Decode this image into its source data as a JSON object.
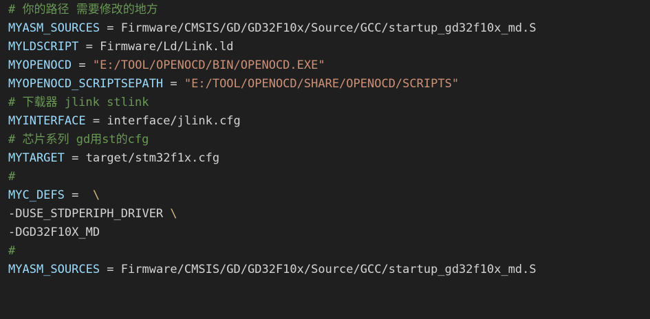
{
  "editor": {
    "lines": [
      {
        "comment": "# 你的路径 需要修改的地方"
      },
      {
        "var": "MYASM_SOURCES",
        "op": " = ",
        "val": "Firmware/CMSIS/GD/GD32F10x/Source/GCC/startup_gd32f10x_md.S"
      },
      {
        "var": "MYLDSCRIPT",
        "op": " = ",
        "val": "Firmware/Ld/Link.ld"
      },
      {
        "var": "MYOPENOCD",
        "op": " = ",
        "str": "\"E:/TOOL/OPENOCD/BIN/OPENOCD.EXE\""
      },
      {
        "var": "MYOPENOCD_SCRIPTSEPATH",
        "op": " = ",
        "str": "\"E:/TOOL/OPENOCD/SHARE/OPENOCD/SCRIPTS\""
      },
      {
        "comment": "# 下载器 jlink stlink"
      },
      {
        "var": "MYINTERFACE",
        "op": " = ",
        "val": "interface/jlink.cfg"
      },
      {
        "comment": "# 芯片系列 gd用st的cfg"
      },
      {
        "var": "MYTARGET",
        "op": " = ",
        "val": "target/stm32f1x.cfg"
      },
      {
        "comment": "#"
      },
      {
        "var": "MYC_DEFS",
        "op": " =  ",
        "cont": "\\"
      },
      {
        "val": "-DUSE_STDPERIPH_DRIVER ",
        "cont": "\\"
      },
      {
        "val": "-DGD32F10X_MD"
      },
      {
        "comment": "#"
      },
      {
        "var": "MYASM_SOURCES",
        "op": " = ",
        "val": "Firmware/CMSIS/GD/GD32F10x/Source/GCC/startup_gd32f10x_md.S"
      }
    ]
  },
  "colors": {
    "background": "#1f1f1f",
    "comment": "#6a9955",
    "variable": "#9cdcfe",
    "text": "#d4d4d4",
    "string": "#ce9178",
    "continuation": "#d7ba7d"
  }
}
